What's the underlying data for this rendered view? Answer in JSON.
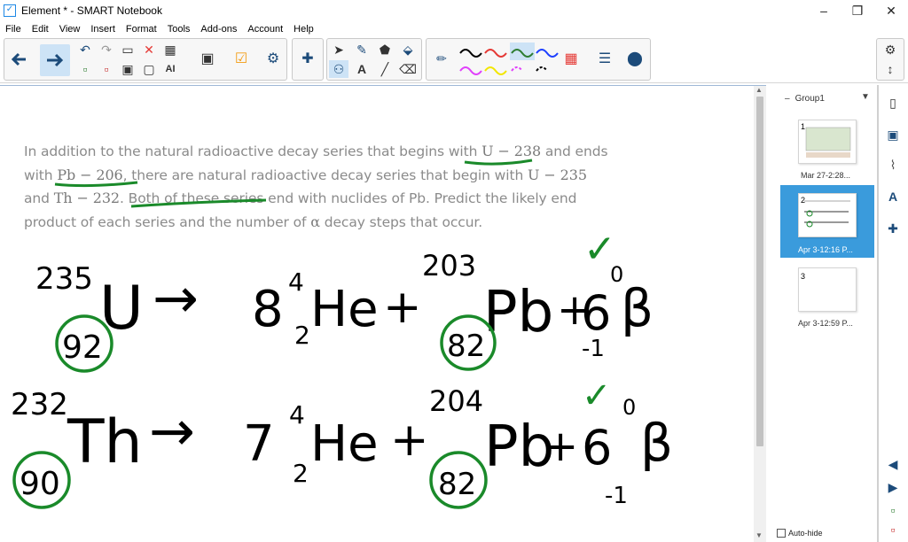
{
  "window": {
    "title": "Element * - SMART Notebook",
    "min": "–",
    "max": "❐",
    "close": "✕"
  },
  "menu": [
    "File",
    "Edit",
    "View",
    "Insert",
    "Format",
    "Tools",
    "Add-ons",
    "Account",
    "Help"
  ],
  "question": {
    "line1_a": "In addition to the natural radioactive decay series that begins with ",
    "line1_m": "U − 238",
    "line1_b": " and ends",
    "line2_a": "with ",
    "line2_m1": "Pb − 206",
    "line2_b": ", there are natural radioactive decay series that begin with ",
    "line2_m2": "U − 235",
    "line3_a": "and ",
    "line3_m": "Th − 232",
    "line3_b": ". Both of these series end with nuclides of Pb. Predict the likely end",
    "line4_a": "product of each series and the number of ",
    "line4_m": "α",
    "line4_b": " decay steps that occur."
  },
  "handwriting": {
    "eq1": {
      "mass": "235",
      "sym": "U",
      "atomic": "92",
      "arrow": "→",
      "coef_he": "8",
      "he_mass": "4",
      "he_atomic": "2",
      "he": "He",
      "plus": "+",
      "pb_mass": "203",
      "pb": "Pb",
      "pb_atomic": "82",
      "plus2": "+",
      "coef_b": "6",
      "b_mass": "0",
      "b_atomic": "-1",
      "beta": "β",
      "check": "✓"
    },
    "eq2": {
      "mass": "232",
      "sym": "Th",
      "atomic": "90",
      "arrow": "→",
      "coef_he": "7",
      "he_mass": "4",
      "he_atomic": "2",
      "he": "He",
      "plus": "+",
      "pb_mass": "204",
      "pb": "Pb",
      "pb_atomic": "82",
      "plus2": "+",
      "coef_b": "6",
      "b_mass": "0",
      "b_atomic": "-1",
      "beta": "β",
      "check": "✓"
    }
  },
  "sidebar": {
    "group": "Group1",
    "pages": [
      {
        "number": "1",
        "caption": "Mar 27-2:28..."
      },
      {
        "number": "2",
        "caption": "Apr 3-12:16 P..."
      },
      {
        "number": "3",
        "caption": "Apr 3-12:59 P..."
      }
    ],
    "autohide_label": "Auto-hide"
  },
  "colors": {
    "accent": "#3a9bdc",
    "ink": "#000000",
    "green": "#1a8a2a",
    "pen_black": "#000000",
    "pen_red": "#e53935",
    "pen_green": "#2e7d32",
    "pen_blue": "#1e40ff",
    "pen_magenta": "#e040fb",
    "pen_yellow": "#f2e600"
  }
}
